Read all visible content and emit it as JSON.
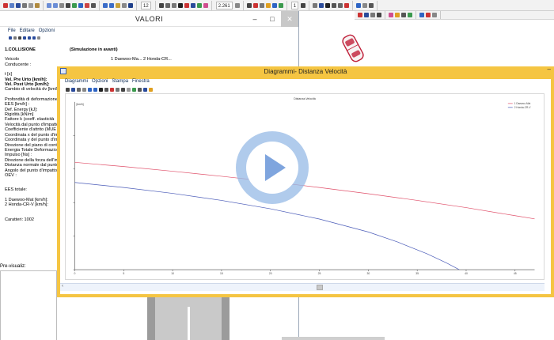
{
  "app": {
    "toolbar_zoom_value": "2.261",
    "toolbar_zoom_small": "12",
    "toolbar_line_value": "1"
  },
  "valori": {
    "title": "VALORI",
    "menu": [
      "File",
      "Editare",
      "Opzioni"
    ],
    "section": "1.COLLISIONE",
    "section_note": "(Simulazione in avanti)",
    "rows": [
      {
        "label": "Veicolo",
        "bold": false
      },
      {
        "label": "Conducente :",
        "bold": false
      },
      {
        "gap": true
      },
      {
        "label": "t [s]",
        "bold": false
      },
      {
        "label": "Vel. Pre Urto [km/h]:",
        "bold": true
      },
      {
        "label": "Vel. Post Urto [km/h]:",
        "bold": true
      },
      {
        "label": "Cambio di velocità dv [km/h]:",
        "bold": false
      },
      {
        "gap": true
      },
      {
        "label": "Profondità di deformazione",
        "bold": false
      },
      {
        "label": "EES [km/h] :",
        "bold": false
      },
      {
        "label": "Def. Energy [kJ]:",
        "bold": false
      },
      {
        "label": "Rigidità [kN/m]",
        "bold": false
      },
      {
        "label": "Fattore k (coeff. elasticità",
        "bold": false
      },
      {
        "label": "Velocità dal punto d'impatto",
        "bold": false
      },
      {
        "label": "Coefficiente d'attrito (MUE",
        "bold": false
      },
      {
        "label": "Coordinata x del punto d'im",
        "bold": false
      },
      {
        "label": "Coordinata y del punto d'im",
        "bold": false
      },
      {
        "label": "Direzione del piano di cont",
        "bold": false
      },
      {
        "label": "Energia Totale Deformazio",
        "bold": false
      },
      {
        "label": "Impulso [Ns] :",
        "bold": false
      },
      {
        "label": "Direzione della forza dell'im",
        "bold": false
      },
      {
        "label": "Distanza normale dal punto",
        "bold": false
      },
      {
        "label": "Angolo del punto d'impatto",
        "bold": false
      },
      {
        "label": "OEV :",
        "bold": false
      },
      {
        "gap": true
      },
      {
        "gap": true
      },
      {
        "label": "EES totale:",
        "bold": false
      },
      {
        "gap": true
      },
      {
        "label": "1  Daewoo-Mat [km/h]:",
        "bold": false
      },
      {
        "label": "2  Honda-CR-V [km/h]:",
        "bold": false
      },
      {
        "gap": true
      },
      {
        "gap": true
      },
      {
        "label": "Caratteri:  1002",
        "bold": false
      }
    ],
    "vehicle_col_text": "1  Daewoo-Ma...    2  Honda-CR...",
    "preview_label": "Pre-visualiz:"
  },
  "diagram": {
    "title": "Diagrammi- Distanza Velocità",
    "menu": [
      "Diagrammi",
      "Opzioni",
      "Stampa",
      "Finestra"
    ],
    "minimize": "–"
  },
  "chart_data": {
    "type": "line",
    "title": "Distanza-Velocità",
    "xlabel": "",
    "ylabel": "[km/h]",
    "x_ticks": [
      "0",
      "5",
      "10",
      "15",
      "20",
      "25",
      "30",
      "35",
      "40",
      "45"
    ],
    "xlim": [
      0,
      47
    ],
    "ylim": [
      0,
      100
    ],
    "grid": false,
    "legend_position": "top-right",
    "series": [
      {
        "name": "1 Daewoo-Mat",
        "color": "#e0506a",
        "x": [
          0,
          5,
          10,
          15,
          20,
          25,
          30,
          35,
          40,
          45,
          47
        ],
        "y": [
          64,
          61.5,
          58.7,
          55.7,
          52.5,
          49,
          45.3,
          41.3,
          37,
          32.2,
          30.3
        ]
      },
      {
        "name": "2 Honda-CR-V",
        "color": "#4a5bb8",
        "x": [
          0,
          5,
          10,
          15,
          20,
          25,
          30,
          33,
          36,
          38,
          39.3
        ],
        "y": [
          52,
          49,
          45.5,
          41.3,
          36.3,
          30.2,
          22.5,
          16.5,
          9.5,
          4,
          0
        ]
      }
    ]
  },
  "overlay": {
    "play_label": "Riproduci video"
  }
}
